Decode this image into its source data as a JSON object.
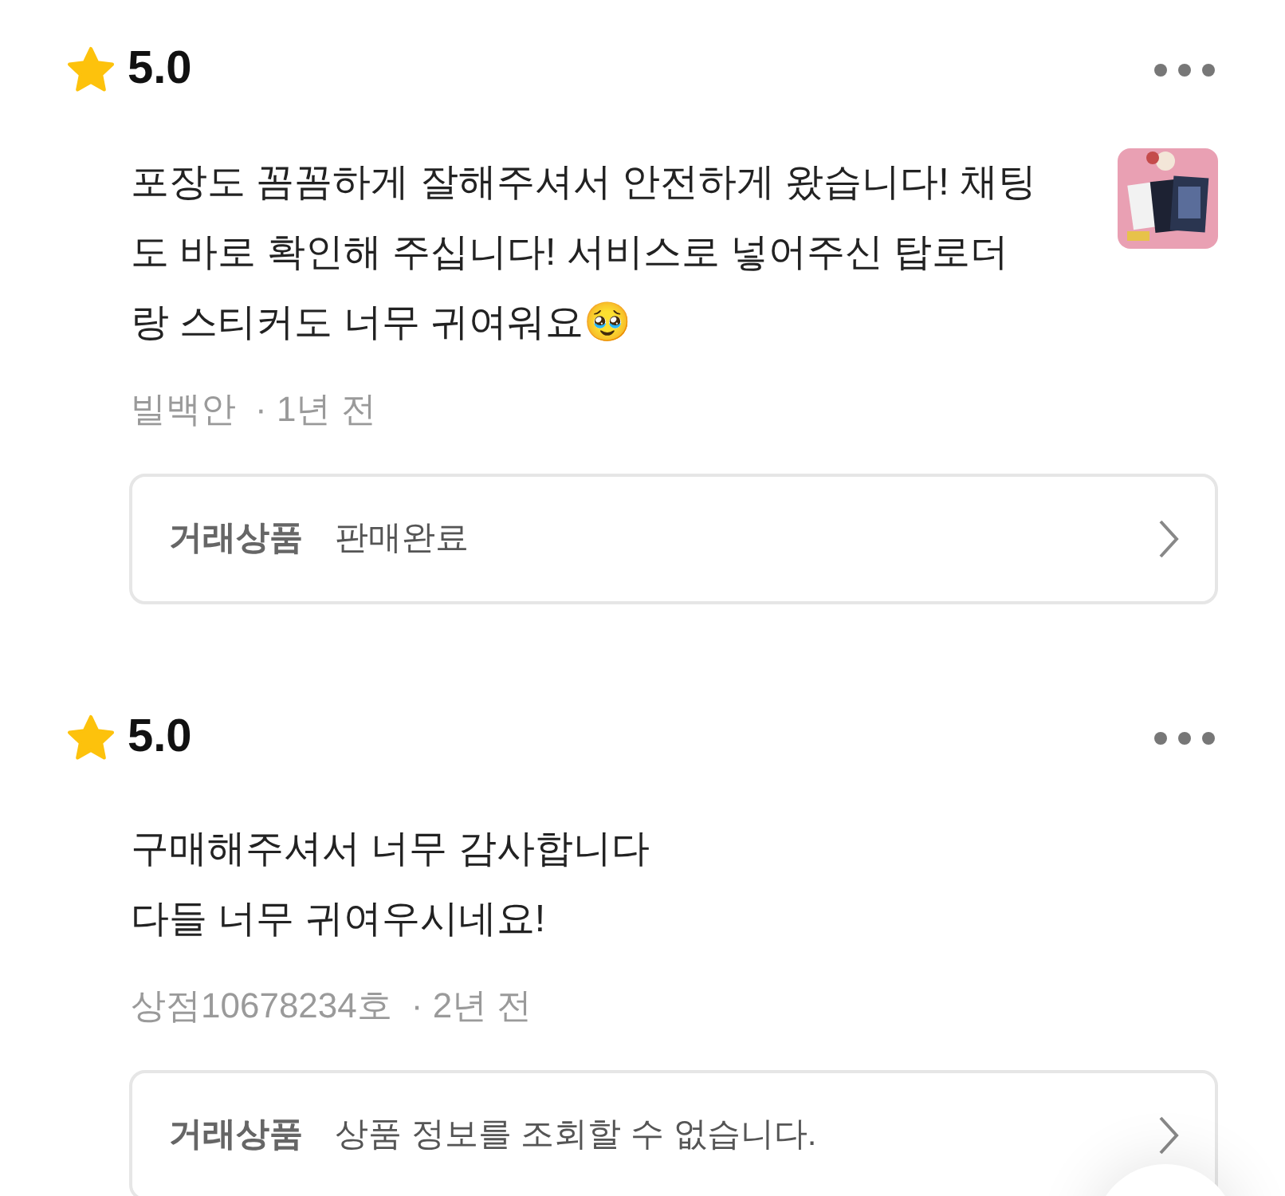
{
  "reviews": [
    {
      "rating": "5.0",
      "lines": [
        "포장도 꼼꼼하게 잘해주셔서 안전하게 왔습니다! 채팅",
        "도 바로 확인해 주십니다! 서비스로 넣어주신 탑로더",
        "랑 스티커도 너무 귀여워요🥹"
      ],
      "author": "빌백안",
      "time": "· 1년 전",
      "product_label": "거래상품",
      "product_status": "판매완료"
    },
    {
      "rating": "5.0",
      "lines": [
        "구매해주셔서 너무 감사합니다",
        "다들 너무 귀여우시네요!"
      ],
      "author": "상점10678234호",
      "time": "· 2년 전",
      "product_label": "거래상품",
      "product_status": "상품 정보를 조회할 수 없습니다."
    }
  ]
}
